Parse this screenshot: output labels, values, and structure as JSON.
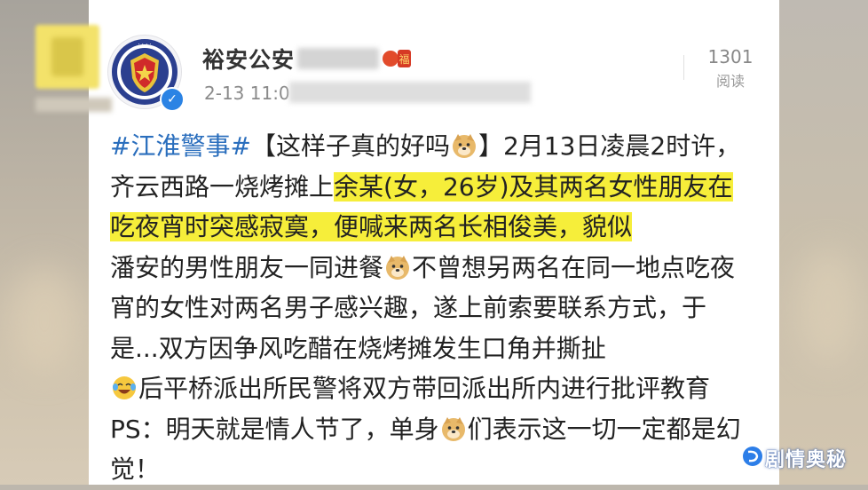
{
  "post": {
    "author_name": "裕安公安",
    "timestamp": "2-13 11:0",
    "read_count": "1301",
    "read_label": "阅读",
    "hashtag": "#江淮警事#",
    "seg_title": "【这样子真的好吗",
    "seg_after_title": "】2月13日凌晨2时许，齐云西路一烧烤摊上",
    "seg_highlight": "余某(女，26岁)及其两名女性朋友在吃夜宵时突感寂寞，便喊来两名长相俊美，貌似",
    "seg_2": "潘安的男性朋友一同进餐",
    "seg_3": "不曾想另两名在同一地点吃夜宵的女性对两名男子感兴趣，遂上前索要联系方式，于是...双方因争风吃醋在烧烤摊发生口角并撕扯",
    "seg_4": "后平桥派出所民警将双方带回派出所内进行批评教育PS：明天就是情人节了，单身",
    "seg_5": "们表示这一切一定都是幻觉！",
    "emoji_doge": "doge-emoji",
    "emoji_cry": "laugh-cry-emoji"
  },
  "avatar": {
    "icon": "police-badge-icon",
    "verified_icon": "verified-check-icon",
    "verified_symbol": "✓"
  },
  "brand": {
    "text": "剧情奥秘",
    "icon": "brand-logo-icon"
  },
  "colors": {
    "hashtag": "#2a6ebd",
    "highlight": "#f6ee3a",
    "verified": "#2b83e4"
  }
}
